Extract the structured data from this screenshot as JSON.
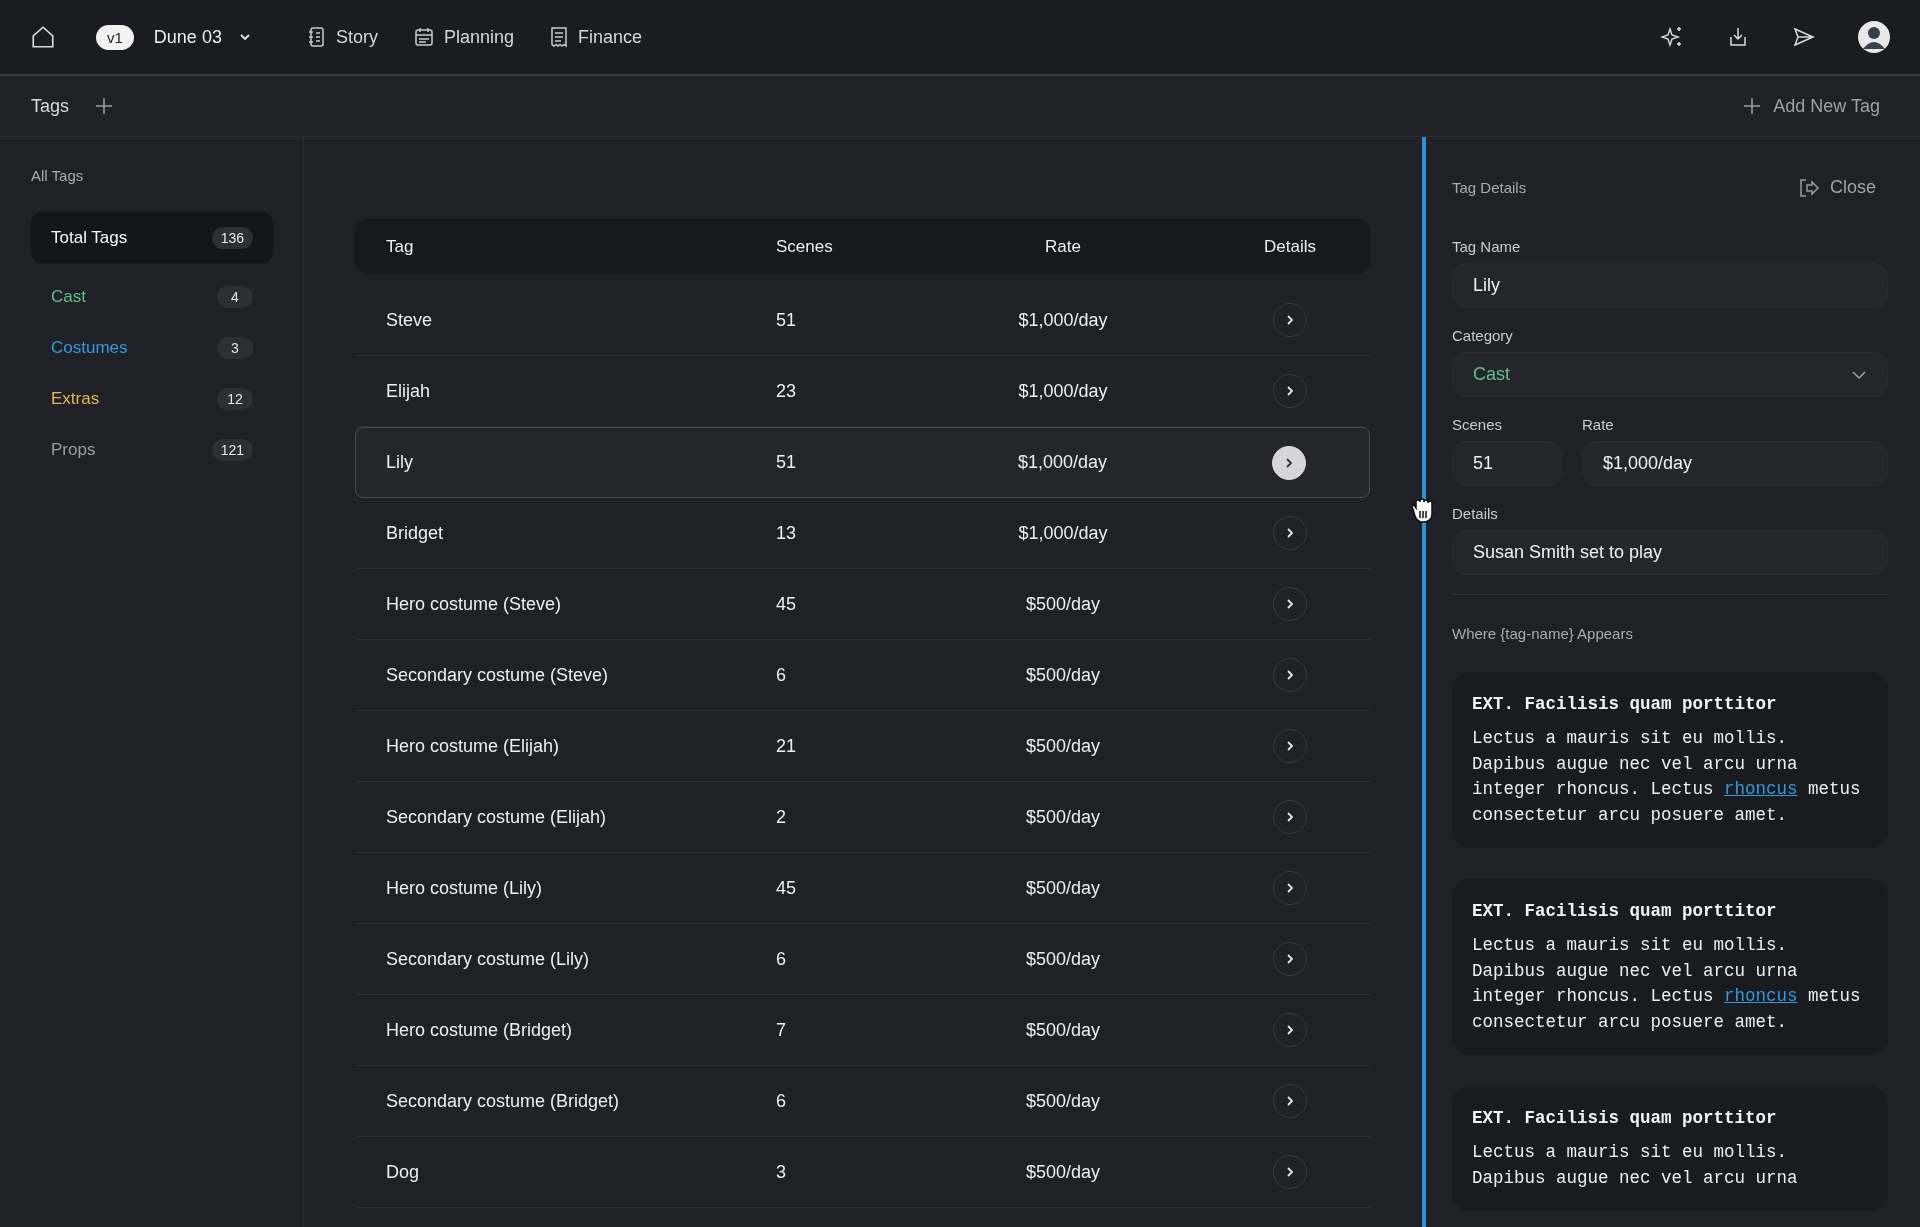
{
  "top_bar": {
    "version": "v1",
    "project": "Dune 03",
    "nav": [
      {
        "label": "Story"
      },
      {
        "label": "Planning"
      },
      {
        "label": "Finance"
      }
    ]
  },
  "sub_bar": {
    "title": "Tags",
    "add_button": "Add New Tag"
  },
  "sidebar": {
    "heading": "All Tags",
    "items": [
      {
        "label": "Total Tags",
        "count": "136",
        "selected": true
      },
      {
        "label": "Cast",
        "count": "4",
        "selected": false,
        "color": "#5fbf8a"
      },
      {
        "label": "Costumes",
        "count": "3",
        "selected": false,
        "color": "#2f9be0"
      },
      {
        "label": "Extras",
        "count": "12",
        "selected": false,
        "color": "#e3b84d"
      },
      {
        "label": "Props",
        "count": "121",
        "selected": false,
        "color": "#9a9ca3"
      }
    ]
  },
  "table": {
    "columns": [
      "Tag",
      "Scenes",
      "Rate",
      "Details"
    ],
    "rows": [
      {
        "tag": "Steve",
        "scenes": "51",
        "rate": "$1,000/day",
        "selected": false
      },
      {
        "tag": "Elijah",
        "scenes": "23",
        "rate": "$1,000/day",
        "selected": false
      },
      {
        "tag": "Lily",
        "scenes": "51",
        "rate": "$1,000/day",
        "selected": true
      },
      {
        "tag": "Bridget",
        "scenes": "13",
        "rate": "$1,000/day",
        "selected": false
      },
      {
        "tag": "Hero costume (Steve)",
        "scenes": "45",
        "rate": "$500/day",
        "selected": false
      },
      {
        "tag": "Secondary costume (Steve)",
        "scenes": "6",
        "rate": "$500/day",
        "selected": false
      },
      {
        "tag": "Hero costume (Elijah)",
        "scenes": "21",
        "rate": "$500/day",
        "selected": false
      },
      {
        "tag": "Secondary costume (Elijah)",
        "scenes": "2",
        "rate": "$500/day",
        "selected": false
      },
      {
        "tag": "Hero costume (Lily)",
        "scenes": "45",
        "rate": "$500/day",
        "selected": false
      },
      {
        "tag": "Secondary costume (Lily)",
        "scenes": "6",
        "rate": "$500/day",
        "selected": false
      },
      {
        "tag": "Hero costume (Bridget)",
        "scenes": "7",
        "rate": "$500/day",
        "selected": false
      },
      {
        "tag": "Secondary costume (Bridget)",
        "scenes": "6",
        "rate": "$500/day",
        "selected": false
      },
      {
        "tag": "Dog",
        "scenes": "3",
        "rate": "$500/day",
        "selected": false
      }
    ]
  },
  "details_panel": {
    "title": "Tag Details",
    "close": "Close",
    "tag_name": {
      "label": "Tag Name",
      "value": "Lily"
    },
    "category": {
      "label": "Category",
      "value": "Cast"
    },
    "scenes": {
      "label": "Scenes",
      "value": "51"
    },
    "rate": {
      "label": "Rate",
      "value": "$1,000/day"
    },
    "details": {
      "label": "Details",
      "value": "Susan Smith set to play"
    },
    "appears_heading": "Where {tag-name} Appears",
    "scenes_list": [
      {
        "heading": "EXT. Facilisis quam porttitor",
        "body": [
          {
            "text": "Lectus a mauris sit eu mollis. Dapibus augue nec vel arcu urna integer rhoncus. Lectus "
          },
          {
            "link": "rhoncus"
          },
          {
            "text": " metus consectetur arcu posuere amet."
          }
        ]
      },
      {
        "heading": "EXT. Facilisis quam porttitor",
        "body": [
          {
            "text": "Lectus a mauris sit eu mollis. Dapibus augue nec vel arcu urna integer rhoncus. Lectus "
          },
          {
            "link": "rhoncus"
          },
          {
            "text": " metus consectetur arcu posuere amet."
          }
        ]
      },
      {
        "heading": "EXT. Facilisis quam porttitor",
        "body": [
          {
            "text": "Lectus a mauris sit eu mollis. Dapibus augue nec vel arcu urna"
          }
        ]
      }
    ]
  }
}
